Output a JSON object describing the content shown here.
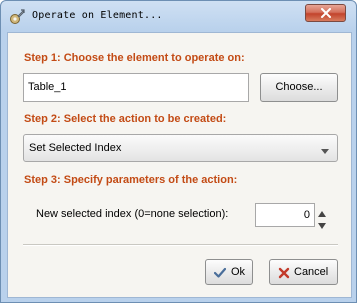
{
  "window": {
    "title": "Operate on Element..."
  },
  "step1": {
    "label": "Step 1: Choose the element to operate on:",
    "element_value": "Table_1",
    "choose_button": "Choose..."
  },
  "step2": {
    "label": "Step 2: Select the action to be created:",
    "selected_action": "Set Selected Index"
  },
  "step3": {
    "label": "Step 3: Specify parameters of the action:",
    "param_label": "New selected index (0=none selection):",
    "param_value": "0"
  },
  "footer": {
    "ok_label": "Ok",
    "cancel_label": "Cancel"
  },
  "icons": {
    "app": "wrench-gear-icon",
    "close": "close-icon",
    "dropdown": "chevron-down-icon",
    "spin_up": "arrow-up-icon",
    "spin_down": "arrow-down-icon",
    "ok": "checkmark-icon",
    "cancel": "x-mark-icon"
  },
  "colors": {
    "step_label": "#c34b15",
    "title_bar": "#b9d1ec",
    "close_button": "#c2442c",
    "cancel_icon": "#c23a2a",
    "ok_icon": "#4a6e9a"
  }
}
